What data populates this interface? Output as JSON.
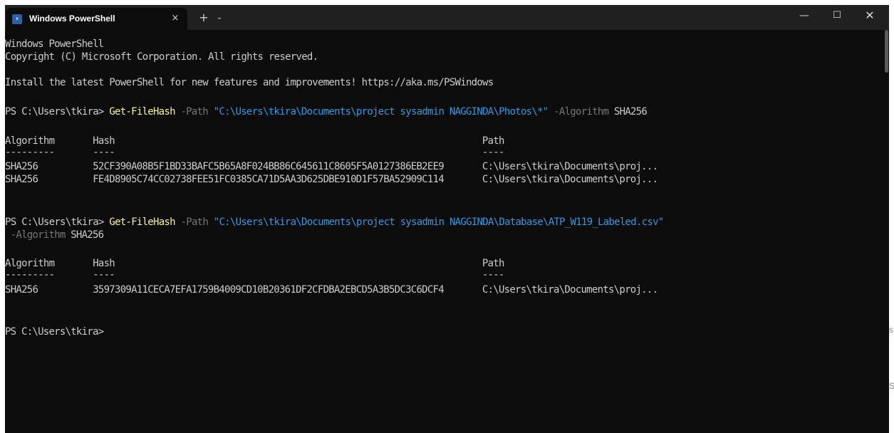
{
  "window": {
    "tab_title": "Windows PowerShell",
    "tab_icon": "powershell-icon",
    "close_tab": "×",
    "new_tab": "+",
    "dropdown": "⌄",
    "minimize": "—",
    "maximize": "☐",
    "close": "✕"
  },
  "terminal": {
    "banner": [
      "Windows PowerShell",
      "Copyright (C) Microsoft Corporation. All rights reserved."
    ],
    "install_msg": "Install the latest PowerShell for new features and improvements! https://aka.ms/PSWindows",
    "cmd1": {
      "prompt": "PS C:\\Users\\tkira> ",
      "cmdlet": "Get-FileHash",
      "p_path": " -Path ",
      "path_str": "\"C:\\Users\\tkira\\Documents\\project sysadmin NAGGINDA\\Photos\\*\"",
      "p_alg": " -Algorithm ",
      "alg_val": "SHA256"
    },
    "table1": {
      "header": "Algorithm       Hash                                                                   Path",
      "divider": "---------       ----                                                                   ----",
      "rows": [
        "SHA256          52CF390A08B5F1BD33BAFC5B65A8F024BB86C645611C8605F5A0127386EB2EE9       C:\\Users\\tkira\\Documents\\proj...",
        "SHA256          FE4D8905C74CC02738FEE51FC0385CA71D5AA3D625DBE910D1F57BA52909C114       C:\\Users\\tkira\\Documents\\proj..."
      ]
    },
    "cmd2": {
      "prompt": "PS C:\\Users\\tkira> ",
      "cmdlet": "Get-FileHash",
      "p_path": " -Path ",
      "path_str": "\"C:\\Users\\tkira\\Documents\\project sysadmin NAGGINDA\\Database\\ATP_W119_Labeled.csv\"",
      "p_alg": " -Algorithm ",
      "alg_val": "SHA256"
    },
    "table2": {
      "header": "Algorithm       Hash                                                                   Path",
      "divider": "---------       ----                                                                   ----",
      "rows": [
        "SHA256          3597309A11CECA7EFA1759B4009CD10B20361DF2CFDBA2EBCD5A3B5DC3C6DCF4       C:\\Users\\tkira\\Documents\\proj..."
      ]
    },
    "final_prompt": "PS C:\\Users\\tkira>"
  },
  "edge_letters": [
    "s",
    "S"
  ]
}
